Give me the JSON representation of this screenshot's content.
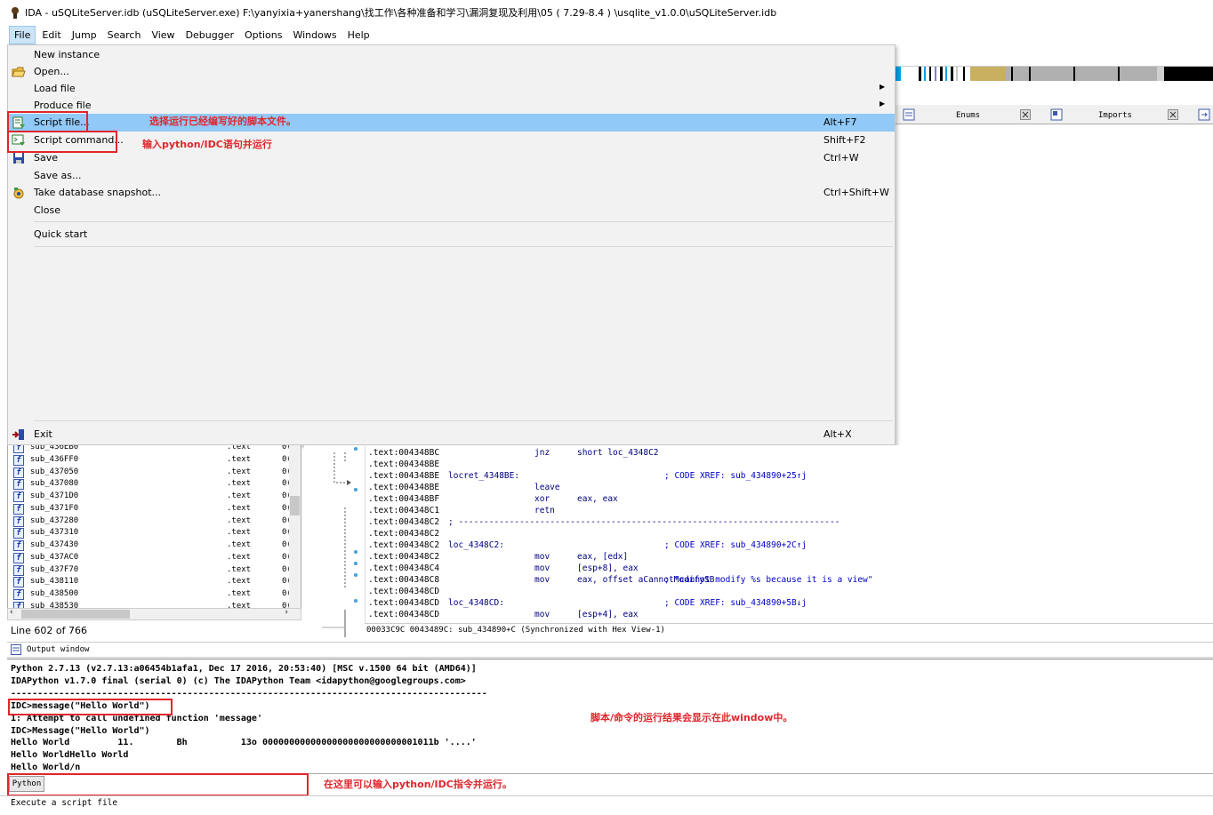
{
  "window": {
    "title": "IDA - uSQLiteServer.idb (uSQLiteServer.exe) F:\\yanyixia+yanershang\\找工作\\各种准备和学习\\漏洞复现及利用\\05 ( 7.29-8.4 ) \\usqlite_v1.0.0\\uSQLiteServer.idb"
  },
  "menubar": [
    "File",
    "Edit",
    "Jump",
    "Search",
    "View",
    "Debugger",
    "Options",
    "Windows",
    "Help"
  ],
  "file_menu": {
    "items": [
      {
        "label": "New instance",
        "shortcut": "",
        "submenu": false,
        "icon": ""
      },
      {
        "label": "Open...",
        "shortcut": "",
        "submenu": false,
        "icon": "folder-open-icon"
      },
      {
        "label": "Load file",
        "shortcut": "",
        "submenu": true,
        "icon": ""
      },
      {
        "label": "Produce file",
        "shortcut": "",
        "submenu": true,
        "icon": ""
      },
      {
        "label": "Script file...",
        "shortcut": "Alt+F7",
        "submenu": false,
        "icon": "script-file-icon"
      },
      {
        "label": "Script command...",
        "shortcut": "Shift+F2",
        "submenu": false,
        "icon": "script-command-icon"
      },
      {
        "label": "Save",
        "shortcut": "Ctrl+W",
        "submenu": false,
        "icon": "save-icon"
      },
      {
        "label": "Save as...",
        "shortcut": "",
        "submenu": false,
        "icon": ""
      },
      {
        "label": "Take database snapshot...",
        "shortcut": "Ctrl+Shift+W",
        "submenu": false,
        "icon": "snapshot-icon"
      },
      {
        "label": "Close",
        "shortcut": "",
        "submenu": false,
        "icon": ""
      },
      {
        "label": "Quick start",
        "shortcut": "",
        "submenu": false,
        "icon": ""
      },
      {
        "label": "Exit",
        "shortcut": "Alt+X",
        "submenu": false,
        "icon": "exit-icon"
      }
    ]
  },
  "annotations": {
    "script_file": "选择运行已经编写好的脚本文件。",
    "script_command": "输入python/IDC语句并运行",
    "output": "脚本/命令的运行结果会显示在此window中。",
    "python_input": "在这里可以输入python/IDC指令并运行。"
  },
  "tabs": {
    "enums": "Enums",
    "imports": "Imports"
  },
  "functions": {
    "rows": [
      {
        "name": "sub_436EB0",
        "segment": ".text",
        "addr": "0("
      },
      {
        "name": "sub_436FF0",
        "segment": ".text",
        "addr": "0("
      },
      {
        "name": "sub_437050",
        "segment": ".text",
        "addr": "0("
      },
      {
        "name": "sub_437080",
        "segment": ".text",
        "addr": "0("
      },
      {
        "name": "sub_4371D0",
        "segment": ".text",
        "addr": "0("
      },
      {
        "name": "sub_4371F0",
        "segment": ".text",
        "addr": "0("
      },
      {
        "name": "sub_437280",
        "segment": ".text",
        "addr": "0("
      },
      {
        "name": "sub_437310",
        "segment": ".text",
        "addr": "0("
      },
      {
        "name": "sub_437430",
        "segment": ".text",
        "addr": "0("
      },
      {
        "name": "sub_437AC0",
        "segment": ".text",
        "addr": "0("
      },
      {
        "name": "sub_437F70",
        "segment": ".text",
        "addr": "0("
      },
      {
        "name": "sub_438110",
        "segment": ".text",
        "addr": "0("
      },
      {
        "name": "sub_438500",
        "segment": ".text",
        "addr": "0("
      },
      {
        "name": "sub_438530",
        "segment": ".text",
        "addr": "0("
      }
    ],
    "line_status": "Line 602 of 766"
  },
  "disasm": {
    "lines": [
      {
        "addr": ".text:004348BC",
        "label": "",
        "op": "jnz",
        "args": "short loc_4348C2",
        "comment": ""
      },
      {
        "addr": ".text:004348BE",
        "label": "",
        "op": "",
        "args": "",
        "comment": ""
      },
      {
        "addr": ".text:004348BE",
        "label": "locret_4348BE:",
        "op": "",
        "args": "",
        "comment": "; CODE XREF: sub_434890+25↑j"
      },
      {
        "addr": ".text:004348BE",
        "label": "",
        "op": "leave",
        "args": "",
        "comment": ""
      },
      {
        "addr": ".text:004348BF",
        "label": "",
        "op": "xor",
        "args": "eax, eax",
        "comment": ""
      },
      {
        "addr": ".text:004348C1",
        "label": "",
        "op": "retn",
        "args": "",
        "comment": ""
      },
      {
        "addr": ".text:004348C2",
        "label": "; ---------------------------------------------------------------------------",
        "op": "",
        "args": "",
        "comment": ""
      },
      {
        "addr": ".text:004348C2",
        "label": "",
        "op": "",
        "args": "",
        "comment": ""
      },
      {
        "addr": ".text:004348C2",
        "label": "loc_4348C2:",
        "op": "",
        "args": "",
        "comment": "; CODE XREF: sub_434890+2C↑j"
      },
      {
        "addr": ".text:004348C2",
        "label": "",
        "op": "mov",
        "args": "eax, [edx]",
        "comment": ""
      },
      {
        "addr": ".text:004348C4",
        "label": "",
        "op": "mov",
        "args": "[esp+8], eax",
        "comment": ""
      },
      {
        "addr": ".text:004348C8",
        "label": "",
        "op": "mov",
        "args": "eax, offset aCannotModifySB",
        "comment": "; \"cannot modify %s because it is a view\""
      },
      {
        "addr": ".text:004348CD",
        "label": "",
        "op": "",
        "args": "",
        "comment": ""
      },
      {
        "addr": ".text:004348CD",
        "label": "loc_4348CD:",
        "op": "",
        "args": "",
        "comment": "; CODE XREF: sub_434890+5B↓j"
      },
      {
        "addr": ".text:004348CD",
        "label": "",
        "op": "mov",
        "args": "[esp+4], eax",
        "comment": ""
      }
    ],
    "sync_status": "00033C9C 0043489C: sub_434890+C (Synchronized with Hex View-1)"
  },
  "output": {
    "title": "Output window",
    "lines": [
      "Python 2.7.13 (v2.7.13:a06454b1afa1, Dec 17 2016, 20:53:40) [MSC v.1500 64 bit (AMD64)]",
      "IDAPython v1.7.0 final (serial 0) (c) The IDAPython Team <idapython@googlegroups.com>",
      "-----------------------------------------------------------------------------------------",
      "IDC>message(\"Hello World\")",
      "1: Attempt to call undefined function 'message'",
      "IDC>Message(\"Hello World\")",
      "Hello World         11.        Bh          13o 00000000000000000000000000001011b '....'",
      "Hello WorldHello World",
      "Hello World/n"
    ]
  },
  "python_input": {
    "button": "Python",
    "value": ""
  },
  "status_bar": "Execute a script file",
  "colors": {
    "highlight": "#91c9f7",
    "annotation": "#e0262c"
  }
}
